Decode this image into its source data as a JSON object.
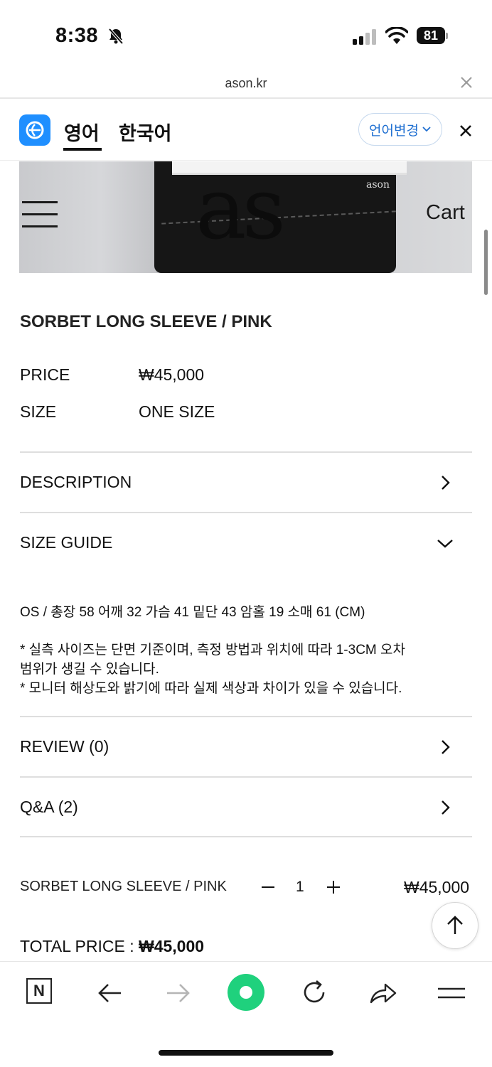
{
  "status": {
    "time": "8:38",
    "battery": "81"
  },
  "browser": {
    "url": "ason.kr"
  },
  "translate": {
    "tab_active": "영어",
    "tab_other": "한국어",
    "change_label": "언어변경"
  },
  "hero": {
    "logo_text": "as",
    "brand_small": "ason",
    "cart_label": "Cart"
  },
  "product": {
    "title": "SORBET LONG SLEEVE / PINK",
    "price_label": "PRICE",
    "price_value": "₩45,000",
    "size_label": "SIZE",
    "size_value": "ONE SIZE"
  },
  "accordion": {
    "description": "DESCRIPTION",
    "size_guide": "SIZE GUIDE",
    "review": "REVIEW (0)",
    "qna": "Q&A (2)"
  },
  "size_guide": {
    "measurements": "OS / 총장 58 어깨 32 가슴 41 밑단 43 암홀 19 소매 61 (CM)",
    "note1_line1": "* 실측 사이즈는 단면 기준이며, 측정 방법과 위치에 따라 1-3CM 오차",
    "note1_line2": "범위가 생길 수 있습니다.",
    "note2": "* 모니터 해상도와 밝기에 따라 실제 색상과 차이가 있을 수 있습니다."
  },
  "order": {
    "item_name": "SORBET LONG SLEEVE / PINK",
    "quantity": "1",
    "item_price": "₩45,000",
    "total_label": "TOTAL PRICE : ",
    "total_value": "₩45,000"
  },
  "bottom_nav": {
    "n_label": "N"
  },
  "colors": {
    "accent_blue": "#1f8fff",
    "green": "#1fd17d"
  }
}
